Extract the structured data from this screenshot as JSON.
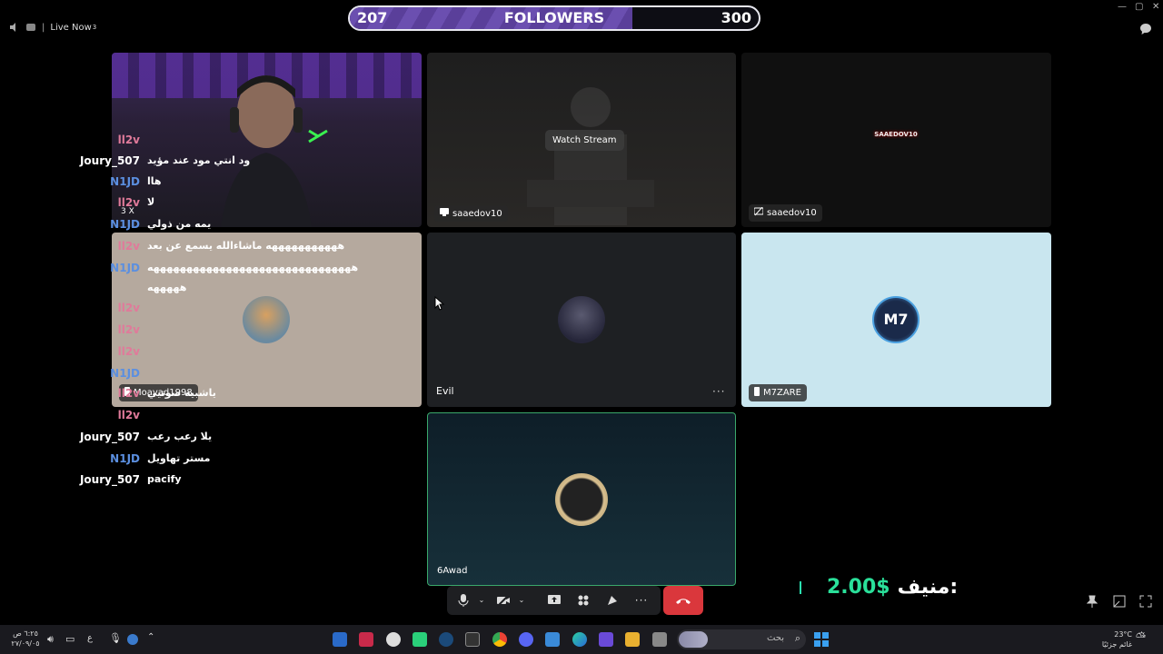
{
  "titlebar": {
    "live_label": "Live Now",
    "live_superscript": "3"
  },
  "followers": {
    "current": "207",
    "label": "FOLLOWERS",
    "goal": "300",
    "progress_fraction": 0.69,
    "fill_color": "#6b4fb0"
  },
  "tiles": {
    "stream1": {
      "overlay_label": "Watch Stream",
      "tag": "saaedov10"
    },
    "stream2": {
      "tag": "saaedov10",
      "logo_text": "SAAEDOV10"
    },
    "moayad": {
      "tag": "Moayad1998"
    },
    "evil": {
      "tag": "Evil"
    },
    "m7zare": {
      "tag": "M7ZARE",
      "logo_text": "M7"
    },
    "awad": {
      "tag": "6Awad"
    },
    "cam_badge": "3 X"
  },
  "chat": [
    {
      "user": "ll2v",
      "msg": "",
      "color": "pink"
    },
    {
      "user": "Joury_507",
      "msg": "ود انتي مود عند مؤيد",
      "color": "white"
    },
    {
      "user": "N1JD",
      "msg": "هاا",
      "color": "blue"
    },
    {
      "user": "ll2v",
      "msg": "لا",
      "color": "pink"
    },
    {
      "user": "N1JD",
      "msg": "يمه من ذولي",
      "color": "blue"
    },
    {
      "user": "ll2v",
      "msg": "هههههههههههه ماشاءالله يسمع عن بعد",
      "color": "pink"
    },
    {
      "user": "N1JD",
      "msg": "هههههههههههههههههههههههههههههههه",
      "color": "blue"
    },
    {
      "user": "",
      "msg": "هههههه",
      "color": "white"
    },
    {
      "user": "ll2v",
      "msg": "",
      "color": "pink"
    },
    {
      "user": "ll2v",
      "msg": "",
      "color": "pink"
    },
    {
      "user": "ll2v",
      "msg": "",
      "color": "pink"
    },
    {
      "user": "N1JD",
      "msg": "",
      "color": "blue"
    },
    {
      "user": "ll2v",
      "msg": "ياشبيه صوتيي",
      "color": "pink"
    },
    {
      "user": "ll2v",
      "msg": "",
      "color": "pink"
    },
    {
      "user": "Joury_507",
      "msg": "يلا رعب رعب",
      "color": "white"
    },
    {
      "user": "N1JD",
      "msg": "مستر تهاويل",
      "color": "blue"
    },
    {
      "user": "Joury_507",
      "msg": "pacify",
      "color": "white"
    }
  ],
  "donation": {
    "label": "منيف:",
    "amount": "2.00$"
  },
  "taskbar": {
    "search_placeholder": "بحث",
    "clock_time": "٦:٢٥ ص",
    "clock_date": "٢٧/٠٩/٠٥",
    "weather_temp": "23°C",
    "weather_desc": "غائم جزئيًا",
    "lang": "ع"
  }
}
